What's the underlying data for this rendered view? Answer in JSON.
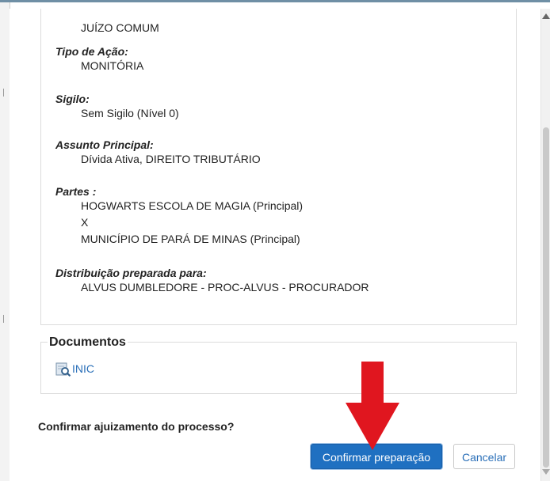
{
  "details": {
    "juizo_value": "JUÍZO COMUM",
    "tipo_acao_label": "Tipo de Ação:",
    "tipo_acao_value": "MONITÓRIA",
    "sigilo_label": "Sigilo:",
    "sigilo_value": "Sem Sigilo (Nível 0)",
    "assunto_label": "Assunto Principal:",
    "assunto_value": "Dívida Ativa, DIREITO TRIBUTÁRIO",
    "partes_label": "Partes :",
    "parte_ativa": "HOGWARTS ESCOLA DE MAGIA (Principal)",
    "versus": "X",
    "parte_passiva": "MUNICÍPIO DE PARÁ DE MINAS (Principal)",
    "distribuicao_label": "Distribuição preparada para:",
    "distribuicao_value": "ALVUS DUMBLEDORE - PROC-ALVUS - PROCURADOR"
  },
  "documents": {
    "title": "Documentos",
    "items": [
      {
        "label": "INIC",
        "icon": "document-search-icon"
      }
    ]
  },
  "confirm": {
    "question": "Confirmar ajuizamento do processo?",
    "primary_label": "Confirmar preparação",
    "cancel_label": "Cancelar"
  },
  "colors": {
    "primary": "#1f70c1",
    "link": "#2a6fb8",
    "annotation_arrow": "#e0161f"
  }
}
